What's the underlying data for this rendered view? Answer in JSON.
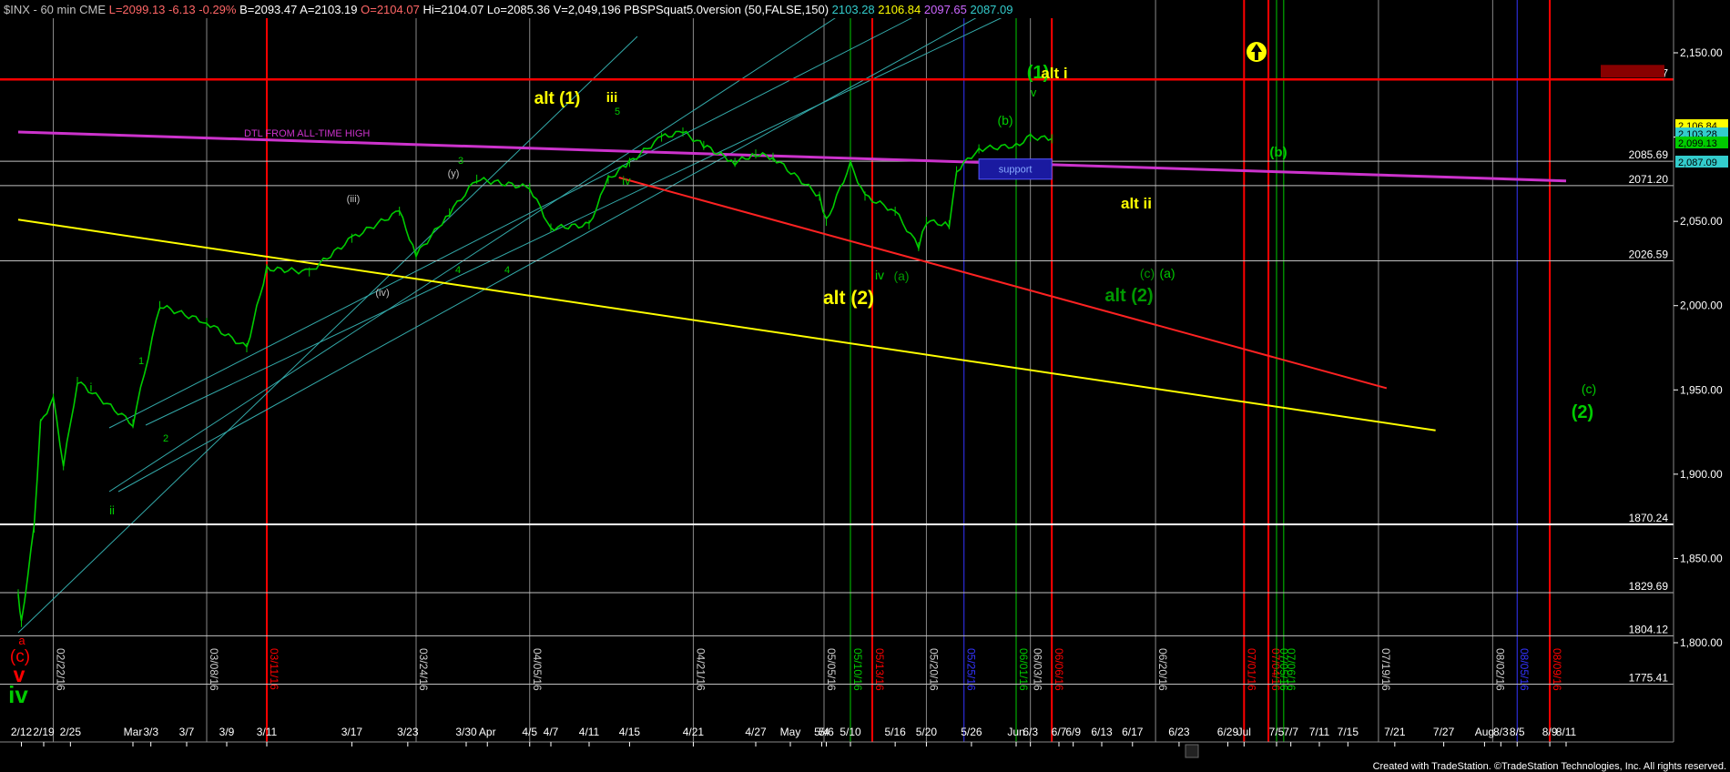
{
  "header": {
    "symbol": "$INX - 60 min",
    "exchange": "CME",
    "last": "L=2099.13",
    "change": "-6.13",
    "pct_change": "-0.29%",
    "bid": "B=2093.47",
    "ask": "A=2103.19",
    "open": "O=2104.07",
    "high": "Hi=2104.07",
    "low": "Lo=2085.36",
    "volume": "V=2,049,196",
    "indicator": "PBSPSquat5.0version (50,FALSE,150)",
    "ind_values": [
      "2103.28",
      "2106.84",
      "2097.65",
      "2087.09"
    ],
    "ind_colors": [
      "#33cccc",
      "#ffff00",
      "#cc66ff",
      "#33cccc"
    ]
  },
  "footer": "Created with TradeStation. ©TradeStation Technologies, Inc. All rights reserved.",
  "chart_data": {
    "type": "line",
    "title": "$INX - 60 min",
    "ylim": [
      1762,
      2172
    ],
    "y_ticks": [
      1800,
      1850,
      1900,
      1950,
      2000,
      2050,
      2100,
      2150
    ],
    "y_tick_labels": [
      "1,800.00",
      "1,850.00",
      "1,900.00",
      "1,950.00",
      "2,000.00",
      "2,050.00",
      "2,100.00",
      "2,150.00"
    ],
    "x_tick_labels": [
      "2/12",
      "2/19",
      "2/25",
      "Mar",
      "3/3",
      "3/7",
      "3/9",
      "3/11",
      "3/17",
      "3/23",
      "3/30",
      "Apr",
      "4/5",
      "4/7",
      "4/11",
      "4/15",
      "4/21",
      "4/27",
      "May",
      "5/4",
      "5/6",
      "5/10",
      "5/16",
      "5/20",
      "5/26",
      "Jun",
      "6/3",
      "6/7",
      "6/9",
      "6/13",
      "6/17",
      "6/23",
      "6/29",
      "Jul",
      "7/5",
      "7/7",
      "7/11",
      "7/15",
      "7/21",
      "7/27",
      "Aug",
      "8/3",
      "8/5",
      "8/9",
      "8/11"
    ],
    "series": [
      {
        "color": "#00cc00",
        "x": [
          "2/11",
          "2/12",
          "2/16",
          "2/18",
          "2/22",
          "2/24",
          "2/26",
          "3/1",
          "3/4",
          "3/8",
          "3/10",
          "3/11",
          "3/14",
          "3/17",
          "3/22",
          "3/24",
          "3/28",
          "3/31",
          "4/5",
          "4/7",
          "4/11",
          "4/13",
          "4/15",
          "4/18",
          "4/20",
          "4/22",
          "4/25",
          "4/27",
          "4/29",
          "5/3",
          "5/6",
          "5/10",
          "5/12",
          "5/16",
          "5/19",
          "5/20",
          "5/23",
          "5/24",
          "5/27",
          "6/1",
          "6/3",
          "6/6"
        ],
        "close": [
          1829,
          1812,
          1868,
          1930,
          1945,
          1905,
          1955,
          1930,
          2000,
          1990,
          1975,
          2022,
          2020,
          2040,
          2056,
          2030,
          2055,
          2075,
          2070,
          2046,
          2048,
          2075,
          2085,
          2100,
          2103,
          2095,
          2085,
          2090,
          2088,
          2065,
          2050,
          2084,
          2065,
          2056,
          2035,
          2050,
          2048,
          2080,
          2093,
          2095,
          2100,
          2099
        ]
      }
    ],
    "horizontal_levels": [
      {
        "value": 2134.17,
        "label": "2134.17",
        "color": "#ff0000"
      },
      {
        "value": 2085.69,
        "label": "2085.69",
        "color": "#c0c0c0"
      },
      {
        "value": 2071.2,
        "label": "2071.20",
        "color": "#c0c0c0"
      },
      {
        "value": 2026.59,
        "label": "2026.59",
        "color": "#c0c0c0"
      },
      {
        "value": 1870.24,
        "label": "1870.24",
        "color": "#ffffff"
      },
      {
        "value": 1829.69,
        "label": "1829.69",
        "color": "#c0c0c0"
      },
      {
        "value": 1804.12,
        "label": "1804.12",
        "color": "#c0c0c0"
      },
      {
        "value": 1775.41,
        "label": "1775.41",
        "color": "#c0c0c0"
      }
    ],
    "price_badges": [
      {
        "value": 2106.84,
        "text": "2,106.84",
        "bg": "#ffff00",
        "fg": "#000000"
      },
      {
        "value": 2103.28,
        "text": "2,103.28",
        "bg": "#33cccc",
        "fg": "#000000"
      },
      {
        "value": 2099.13,
        "text": "2,099.13",
        "bg": "#00cc00",
        "fg": "#000000"
      },
      {
        "value": 2087.09,
        "text": "2,087.09",
        "bg": "#33cccc",
        "fg": "#000000"
      }
    ],
    "trendlines": [
      {
        "label": "DTL FROM ALL-TIME HIGH",
        "color": "#cc33cc",
        "from": [
          "2/11",
          2103
        ],
        "to": [
          "8/11",
          2074
        ]
      },
      {
        "color": "#ffff00",
        "from": [
          "2/11",
          2051
        ],
        "to": [
          "7/26",
          1926
        ]
      },
      {
        "color": "#ff2222",
        "from": [
          "4/14",
          2076
        ],
        "to": [
          "7/20",
          1951
        ]
      }
    ],
    "vertical_dates": [
      {
        "label": "02/22/16",
        "color": "#888888"
      },
      {
        "label": "03/08/16",
        "color": "#888888"
      },
      {
        "label": "03/11/16",
        "color": "#ff0000"
      },
      {
        "label": "03/24/16",
        "color": "#888888"
      },
      {
        "label": "04/05/16",
        "color": "#888888"
      },
      {
        "label": "04/21/16",
        "color": "#888888"
      },
      {
        "label": "05/05/16",
        "color": "#888888"
      },
      {
        "label": "05/10/16",
        "color": "#00cc00"
      },
      {
        "label": "05/13/16",
        "color": "#ff0000"
      },
      {
        "label": "05/20/16",
        "color": "#888888"
      },
      {
        "label": "05/25/16",
        "color": "#3333ff"
      },
      {
        "label": "06/01/16",
        "color": "#00cc00"
      },
      {
        "label": "06/03/16",
        "color": "#888888"
      },
      {
        "label": "06/06/16",
        "color": "#ff0000"
      },
      {
        "label": "06/20/16",
        "color": "#888888"
      },
      {
        "label": "07/01/16",
        "color": "#ff0000"
      },
      {
        "label": "07/04/16",
        "color": "#ff0000"
      },
      {
        "label": "07/05/16",
        "color": "#00cc00"
      },
      {
        "label": "07/06/16",
        "color": "#00cc00"
      },
      {
        "label": "07/19/16",
        "color": "#888888"
      },
      {
        "label": "08/02/16",
        "color": "#888888"
      },
      {
        "label": "08/05/16",
        "color": "#3333ff"
      },
      {
        "label": "08/09/16",
        "color": "#ff0000"
      }
    ],
    "support_zone": {
      "label": "support",
      "from": "5/27",
      "to": "6/6",
      "top": 2087,
      "bottom": 2075
    },
    "annotations": [
      {
        "text": "(1)",
        "color": "#00cc00"
      },
      {
        "text": "alt i",
        "color": "#ffff00"
      },
      {
        "text": "alt (1)",
        "color": "#ffff00"
      },
      {
        "text": "iii",
        "color": "#ffff00"
      },
      {
        "text": "alt ii",
        "color": "#ffff00"
      },
      {
        "text": "alt (2)",
        "color": "#ffff00"
      },
      {
        "text": "(c)",
        "color": "#009900"
      },
      {
        "text": "(a)",
        "color": "#00cc00"
      },
      {
        "text": "alt (2)",
        "color": "#009900"
      },
      {
        "text": "(b)",
        "color": "#00cc00"
      },
      {
        "text": "(c)",
        "color": "#00cc00"
      },
      {
        "text": "(2)",
        "color": "#00cc00"
      },
      {
        "text": "iv",
        "color": "#00cc00"
      },
      {
        "text": "(a)",
        "color": "#009900"
      },
      {
        "text": "v",
        "color": "#00cc00"
      },
      {
        "text": "(b)",
        "color": "#00cc00"
      },
      {
        "text": "i",
        "color": "#00cc00"
      },
      {
        "text": "ii",
        "color": "#00cc00"
      },
      {
        "text": "1",
        "color": "#00cc00"
      },
      {
        "text": "2",
        "color": "#00cc00"
      },
      {
        "text": "3",
        "color": "#00cc00"
      },
      {
        "text": "4",
        "color": "#00cc00"
      },
      {
        "text": "4",
        "color": "#00cc00"
      },
      {
        "text": "5",
        "color": "#00cc00"
      },
      {
        "text": "(iii)",
        "color": "#c0c0c0"
      },
      {
        "text": "(iv)",
        "color": "#c0c0c0"
      },
      {
        "text": "(y)",
        "color": "#c0c0c0"
      },
      {
        "text": "iv",
        "color": "#00cc00"
      },
      {
        "text": "a",
        "color": "#ff0000"
      },
      {
        "text": "(c)",
        "color": "#ff0000"
      },
      {
        "text": "v",
        "color": "#ff0000"
      },
      {
        "text": "iv",
        "color": "#00cc00"
      }
    ],
    "grid": false
  }
}
